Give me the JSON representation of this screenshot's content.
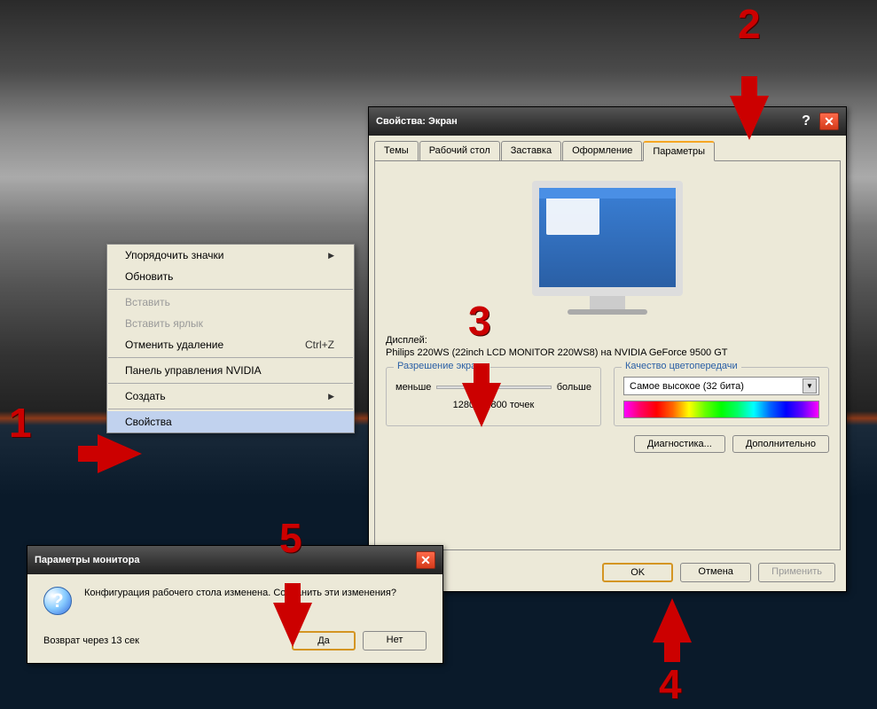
{
  "contextMenu": {
    "items": [
      {
        "label": "Упорядочить значки",
        "hasSubmenu": true
      },
      {
        "label": "Обновить"
      }
    ],
    "items2": [
      {
        "label": "Вставить",
        "disabled": true
      },
      {
        "label": "Вставить ярлык",
        "disabled": true
      },
      {
        "label": "Отменить удаление",
        "shortcut": "Ctrl+Z"
      }
    ],
    "items3": [
      {
        "label": "Панель управления NVIDIA"
      }
    ],
    "items4": [
      {
        "label": "Создать",
        "hasSubmenu": true
      }
    ],
    "items5": [
      {
        "label": "Свойства",
        "highlight": true
      }
    ]
  },
  "displayProps": {
    "title": "Свойства: Экран",
    "tabs": [
      "Темы",
      "Рабочий стол",
      "Заставка",
      "Оформление",
      "Параметры"
    ],
    "activeTab": 4,
    "displayLabel": "Дисплей:",
    "displayValue": "Philips 220WS (22inch LCD MONITOR 220WS8) на NVIDIA GeForce 9500 GT",
    "resolution": {
      "legend": "Разрешение экрана",
      "less": "меньше",
      "more": "больше",
      "value": "1280 на 800 точек"
    },
    "colorQuality": {
      "legend": "Качество цветопередачи",
      "selected": "Самое высокое (32 бита)"
    },
    "diagBtn": "Диагностика...",
    "advBtn": "Дополнительно",
    "okBtn": "OK",
    "cancelBtn": "Отмена",
    "applyBtn": "Применить"
  },
  "confirm": {
    "title": "Параметры монитора",
    "message": "Конфигурация рабочего стола изменена. Сохранить эти изменения?",
    "countdown": "Возврат через 13 сек",
    "yesBtn": "Да",
    "noBtn": "Нет"
  },
  "annotations": {
    "n1": "1",
    "n2": "2",
    "n3": "3",
    "n4": "4",
    "n5": "5"
  }
}
